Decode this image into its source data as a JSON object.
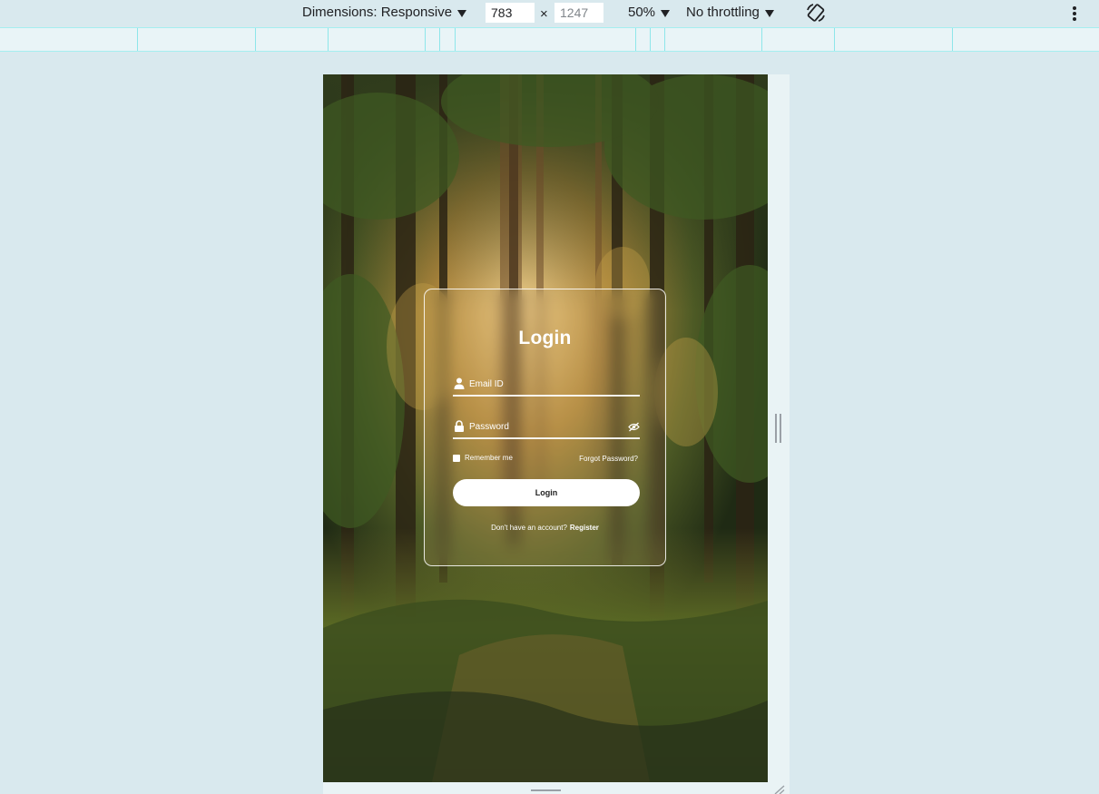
{
  "devtools": {
    "dimensions_label": "Dimensions: Responsive",
    "width_value": "783",
    "height_placeholder": "1247",
    "times_symbol": "×",
    "zoom_label": "50%",
    "throttling_label": "No throttling",
    "icons": [
      "chevron-down-icon",
      "rotate-device-icon",
      "more-options-icon"
    ]
  },
  "login": {
    "title": "Login",
    "email_placeholder": "Email ID",
    "password_placeholder": "Password",
    "remember_label": "Remember me",
    "forgot_label": "Forgot Password?",
    "button_label": "Login",
    "register_prompt": "Don't have an account?",
    "register_link": "Register",
    "icons": [
      "user-icon",
      "lock-icon",
      "eye-off-icon",
      "checkbox"
    ]
  },
  "colors": {
    "toolbar_bg": "#d9e9ee",
    "ruler_line": "#8ee6ea",
    "card_border": "#ffffff",
    "button_bg": "#ffffff"
  }
}
